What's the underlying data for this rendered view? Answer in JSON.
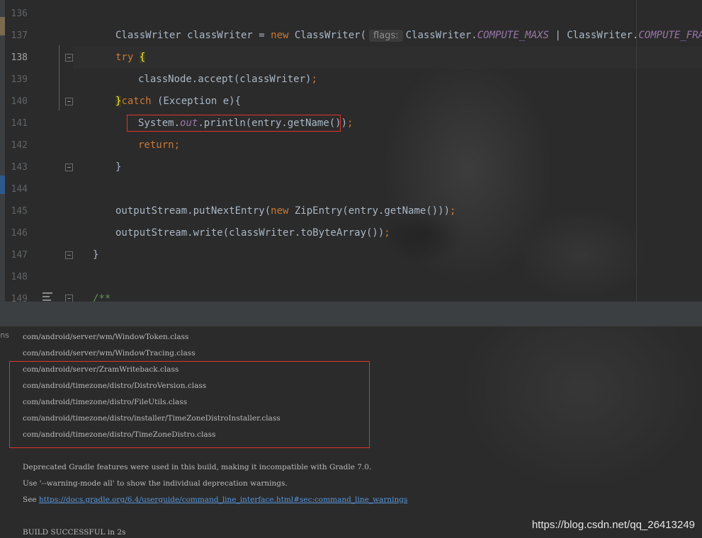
{
  "editor": {
    "lines": [
      {
        "num": "136"
      },
      {
        "num": "137",
        "var_decl": "ClassWriter classWriter = ",
        "kw_new": "new",
        "ctor": " ClassWriter(",
        "hint": "flags:",
        "arg1_class": "ClassWriter.",
        "arg1_field": "COMPUTE_MAXS",
        "op": " | ",
        "arg2_class": "ClassWriter.",
        "arg2_field": "COMPUTE_FRAMES",
        "end": ");"
      },
      {
        "num": "138",
        "kw_try": "try",
        "brace": "{"
      },
      {
        "num": "139",
        "code": "classNode.accept(classWriter)",
        "semi": ";"
      },
      {
        "num": "140",
        "brace": "}",
        "kw_catch": "catch",
        "rest": " (Exception e){"
      },
      {
        "num": "141",
        "cls": "System.",
        "field": "out",
        "rest": ".println(entry.getName())",
        "semi": ";"
      },
      {
        "num": "142",
        "kw_return": "return",
        "semi": ";"
      },
      {
        "num": "143",
        "code": "}"
      },
      {
        "num": "144"
      },
      {
        "num": "145",
        "pre": "outputStream.putNextEntry(",
        "kw_new": "new",
        "post": " ZipEntry(entry.getName()))",
        "semi": ";"
      },
      {
        "num": "146",
        "code": "outputStream.write(classWriter.toByteArray())",
        "semi": ";"
      },
      {
        "num": "147",
        "code": "}"
      },
      {
        "num": "148"
      },
      {
        "num": "149",
        "comment": "/**"
      }
    ]
  },
  "console": {
    "side_label": "ns",
    "class_lines": [
      "com/android/server/wm/WindowToken.class",
      "com/android/server/wm/WindowTracing.class",
      "com/android/server/ZramWriteback.class",
      "com/android/timezone/distro/DistroVersion.class",
      "com/android/timezone/distro/FileUtils.class",
      "com/android/timezone/distro/installer/TimeZoneDistroInstaller.class",
      "com/android/timezone/distro/TimeZoneDistro.class"
    ],
    "deprecation": "Deprecated Gradle features were used in this build, making it incompatible with Gradle 7.0.",
    "warning_mode": "Use '--warning-mode all' to show the individual deprecation warnings.",
    "see_prefix": "See ",
    "see_link": "https://docs.gradle.org/6.4/userguide/command_line_interface.html#sec:command_line_warnings",
    "build_status": "BUILD SUCCESSFUL in 2s"
  },
  "watermark": "https://blog.csdn.net/qq_26413249",
  "colors": {
    "keyword": "#cc7832",
    "field": "#9876aa",
    "plain": "#a9b7c6",
    "highlight_box": "#e0342d",
    "link": "#5897dc"
  }
}
